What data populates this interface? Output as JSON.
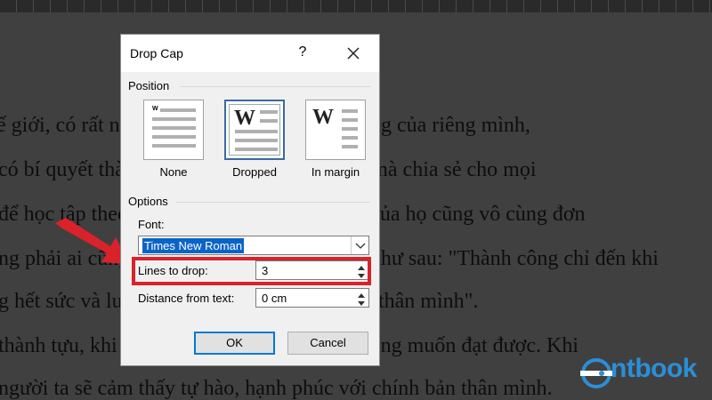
{
  "document": {
    "lines": [
      "ế giới, có rất nhiều người đạt được thành công của riêng mình,",
      "có bí quyết thành công và không ngần ngại mà chia sẻ cho mọi",
      "để học tập theo. Những câu nói thành công của họ cũng vô cùng đơn",
      "ng phải ai cũng hiểu. Một câu nói tiêu biểu như sau: \"Thành công chỉ đến khi",
      "g hết sức và luôn nỗ lực vượt qua chính bản thân mình\".",
      "thành tựu, khi đạt được những điều mình mong muốn đạt được. Khi",
      "người ta sẽ cảm thấy tự hào, hạnh phúc với chính bản thân mình."
    ]
  },
  "dialog": {
    "title": "Drop Cap",
    "help_label": "?",
    "position_section": "Position",
    "position_options": [
      {
        "label": "None",
        "preview_letter": "W"
      },
      {
        "label": "Dropped",
        "preview_letter": "W"
      },
      {
        "label": "In margin",
        "preview_letter": "W"
      }
    ],
    "selected_position": "Dropped",
    "options_section": "Options",
    "font_label": "Font:",
    "font_value": "Times New Roman",
    "lines_label": "Lines to drop:",
    "lines_value": "3",
    "distance_label": "Distance from text:",
    "distance_value": "0 cm",
    "ok_label": "OK",
    "cancel_label": "Cancel"
  },
  "annotation": {
    "highlight_color": "#d9222a"
  },
  "watermark": {
    "brand_text": "ntbook",
    "brand_color": "#2a8fd8"
  }
}
